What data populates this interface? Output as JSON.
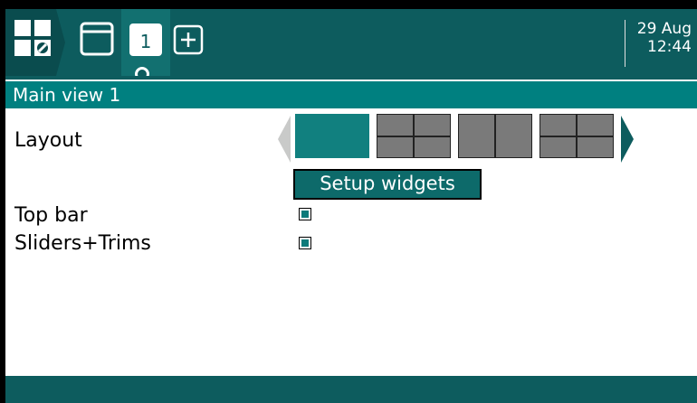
{
  "header": {
    "date": "29 Aug",
    "time": "12:44",
    "active_tab_number": "1",
    "icons": [
      "main-menu-icon",
      "view-window-icon",
      "add-view-icon"
    ]
  },
  "page_title": "Main view 1",
  "layout": {
    "label": "Layout",
    "options": [
      "full",
      "grid-2x2",
      "split-columns",
      "grid-2x2-alt"
    ],
    "selected_index": 0
  },
  "setup_widgets_label": "Setup widgets",
  "options": [
    {
      "label": "Top bar",
      "checked": true
    },
    {
      "label": "Sliders+Trims",
      "checked": true
    }
  ],
  "colors": {
    "topbar": "#0d5c5e",
    "accent": "#008080",
    "selected": "#11807f",
    "option": "#7a7a7a"
  }
}
